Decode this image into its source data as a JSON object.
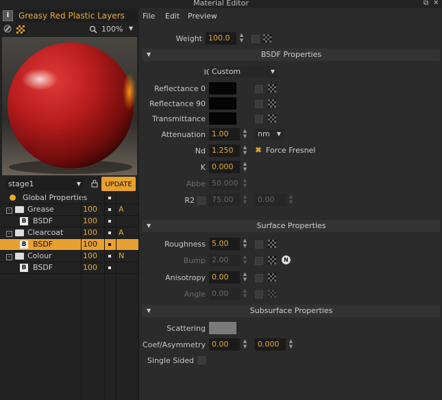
{
  "window": {
    "title": "Material Editor"
  },
  "material": {
    "name": "Greasy Red Plastic Layers",
    "zoom": "100%"
  },
  "stage": {
    "selected": "stage1",
    "update_label": "UPDATE"
  },
  "layers": [
    {
      "name": "Global Properties",
      "value": "",
      "flag": "",
      "selected": false
    },
    {
      "name": "Grease",
      "value": "100",
      "flag": "A",
      "selected": false
    },
    {
      "name": "BSDF",
      "value": "100",
      "flag": "",
      "selected": false
    },
    {
      "name": "Clearcoat",
      "value": "100",
      "flag": "A",
      "selected": false
    },
    {
      "name": "BSDF",
      "value": "100",
      "flag": "",
      "selected": true
    },
    {
      "name": "Colour",
      "value": "100",
      "flag": "N",
      "selected": false
    },
    {
      "name": "BSDF",
      "value": "100",
      "flag": "",
      "selected": false
    }
  ],
  "menu": {
    "file": "File",
    "edit": "Edit",
    "preview": "Preview"
  },
  "weight": {
    "label": "Weight",
    "value": "100.0"
  },
  "bsdf": {
    "title": "BSDF Properties",
    "ior_label": "IOR",
    "ior_value": "Custom",
    "reflectance0": "Reflectance 0",
    "reflectance90": "Reflectance 90",
    "transmittance": "Transmittance",
    "attenuation_label": "Attenuation",
    "attenuation_value": "1.00",
    "attenuation_unit": "nm",
    "nd_label": "Nd",
    "nd_value": "1.250",
    "force_fresnel": "Force Fresnel",
    "k_label": "K",
    "k_value": "0.000",
    "abbe_label": "Abbe",
    "abbe_value": "50.000",
    "r2_label": "R2",
    "r2_value1": "75.00",
    "r2_value2": "0.00"
  },
  "surface": {
    "title": "Surface Properties",
    "roughness_label": "Roughness",
    "roughness_value": "5.00",
    "bump_label": "Bump",
    "bump_value": "2.00",
    "anisotropy_label": "Anisotropy",
    "anisotropy_value": "0.00",
    "angle_label": "Angle",
    "angle_value": "0.00"
  },
  "subsurface": {
    "title": "Subsurface Properties",
    "scattering_label": "Scattering",
    "coef_label": "Coef/Asymmetry",
    "coef_value1": "0.00",
    "coef_value2": "0.000",
    "single_sided_label": "Single Sided"
  },
  "colors": {
    "accent": "#e8a838",
    "selection": "#e8a030",
    "background": "#2b2b2b"
  }
}
